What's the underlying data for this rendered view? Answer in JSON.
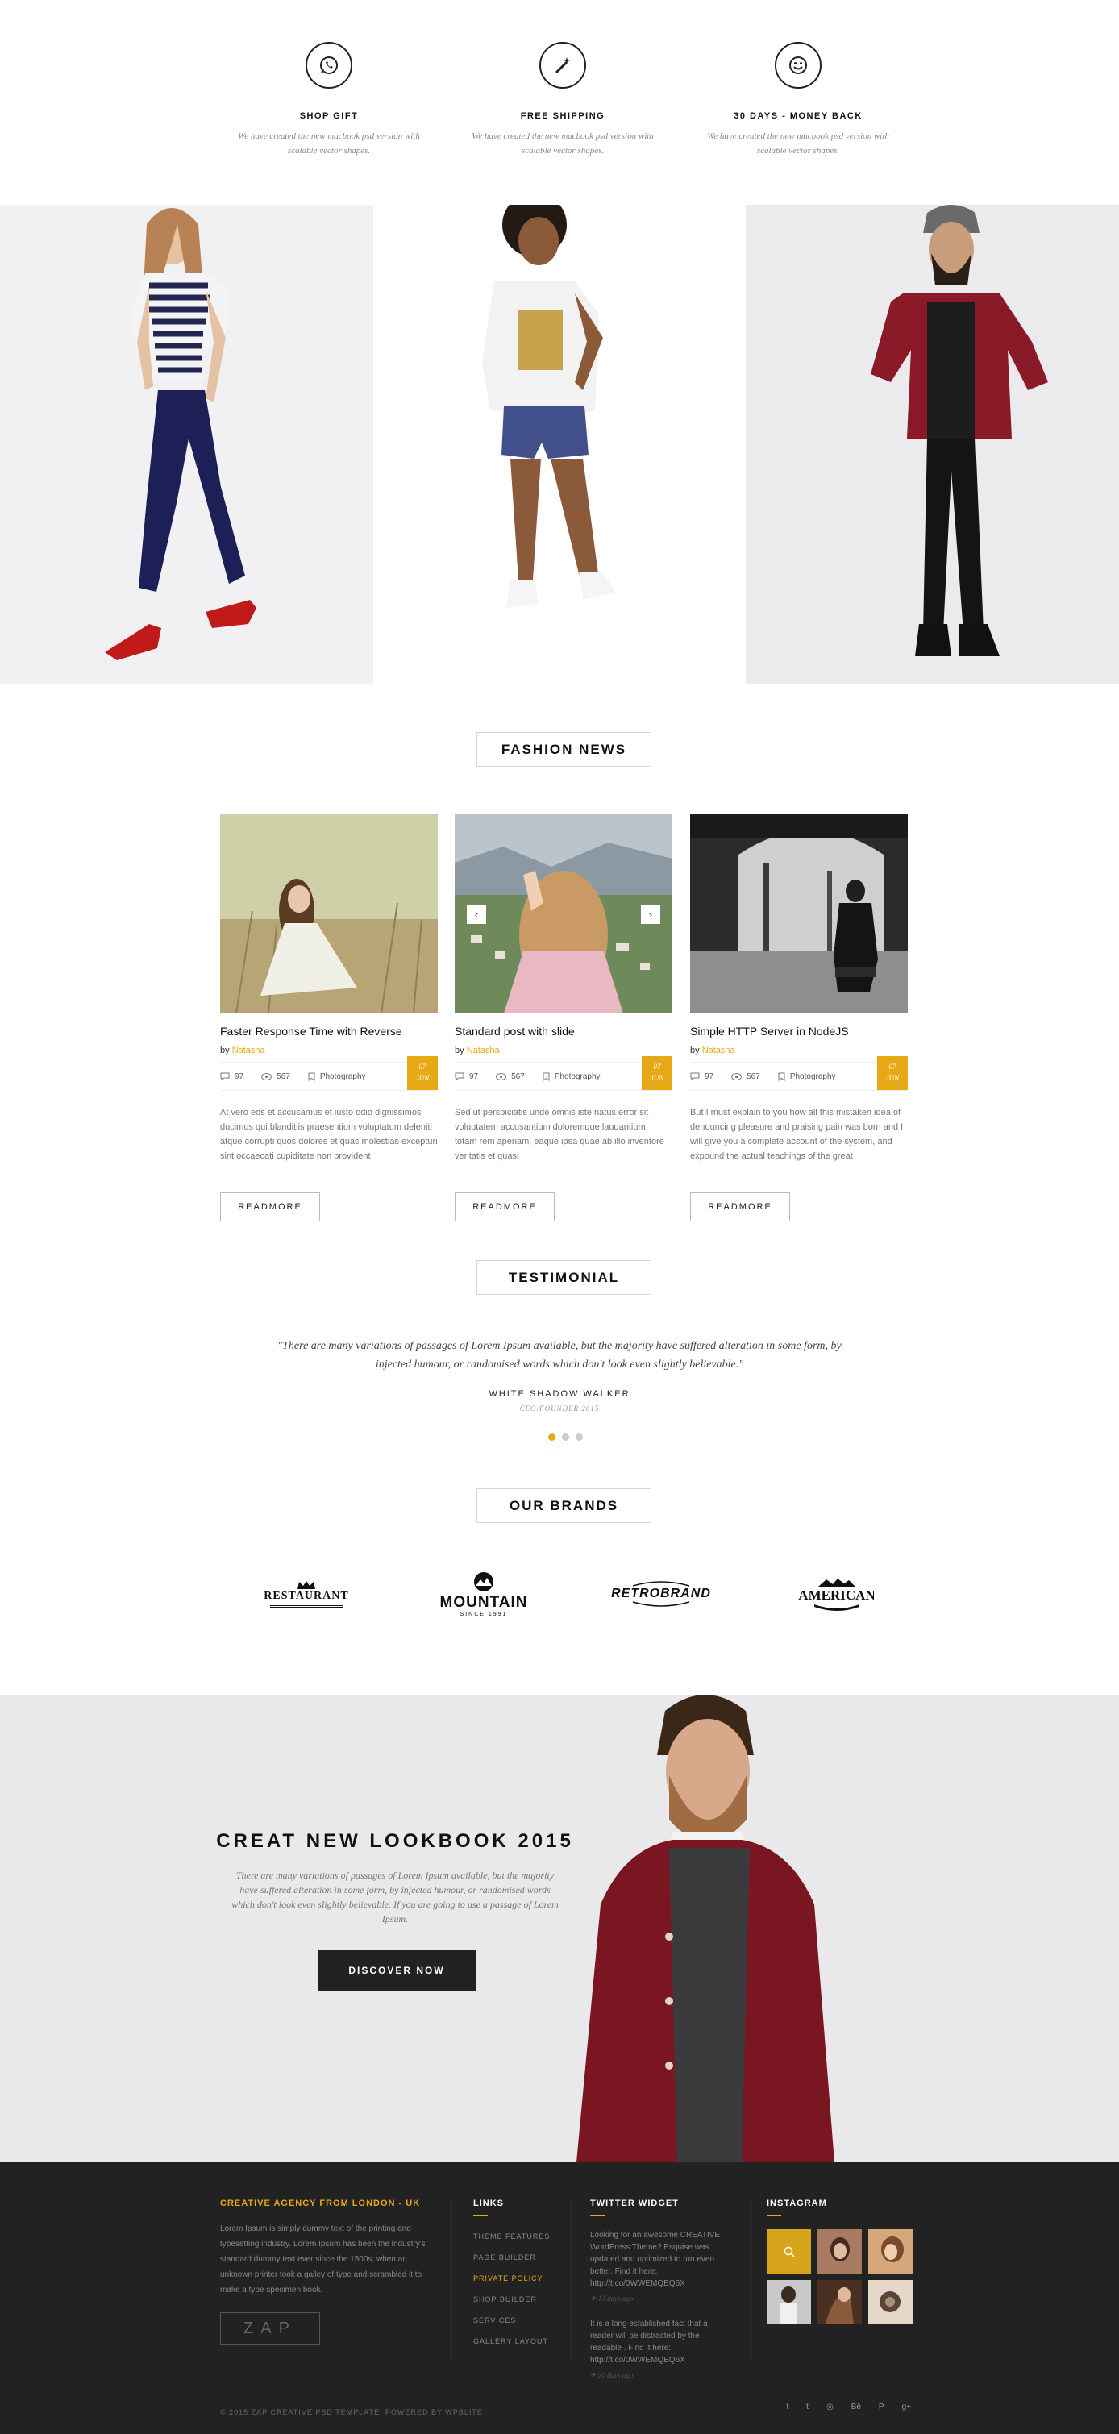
{
  "features": [
    {
      "icon": "whatsapp-icon",
      "title": "SHOP GIFT",
      "desc": "We have created the new macbook psd version with scalable vector shapes."
    },
    {
      "icon": "magic-wand-icon",
      "title": "FREE SHIPPING",
      "desc": "We have created the new macbook psd version with scalable vector shapes."
    },
    {
      "icon": "smile-icon",
      "title": "30 DAYS -  MONEY BACK",
      "desc": "We have created the new macbook psd version with scalable vector shapes."
    }
  ],
  "news": {
    "heading": "FASHION NEWS",
    "posts": [
      {
        "title": "Faster Response Time with Reverse",
        "by": "by",
        "author": "Natasha",
        "comments": "97",
        "views": "567",
        "category": "Photography",
        "day": "07",
        "month": "JUN",
        "excerpt": "At vero eos et accusamus et iusto odio dignissimos ducimus qui blanditiis praesentium voluptatum deleniti atque corrupti quos dolores et quas molestias excepturi sint occaecati cupiditate non provident",
        "button": "READMORE"
      },
      {
        "title": "Standard post with slide",
        "by": "by",
        "author": "Natasha",
        "comments": "97",
        "views": "567",
        "category": "Photography",
        "day": "07",
        "month": "JUN",
        "excerpt": "Sed ut perspiciatis unde omnis iste natus error sit voluptatem accusantium doloremque laudantium, totam rem aperiam, eaque ipsa quae ab illo inventore veritatis et quasi",
        "button": "READMORE",
        "prev": "‹",
        "next": "›"
      },
      {
        "title": "Simple HTTP Server in NodeJS",
        "by": "by",
        "author": "Natasha",
        "comments": "97",
        "views": "567",
        "category": "Photography",
        "day": "07",
        "month": "JUN",
        "excerpt": "But I must explain to you how all this mistaken idea of denouncing pleasure and praising pain was born and I will give you a complete account of the system, and expound the actual teachings of the great",
        "button": "READMORE"
      }
    ]
  },
  "testimonial": {
    "heading": "TESTIMONIAL",
    "quote": "\"There are many variations of passages of Lorem Ipsum available, but the majority have suffered alteration in some form, by injected humour, or randomised words which don't look even slightly believable.\"",
    "author": "WHITE SHADOW WALKER",
    "role": "CEO/FOUNDER 2015"
  },
  "brands": {
    "heading": "OUR BRANDS",
    "items": [
      {
        "name": "RESTAURANT"
      },
      {
        "name": "MOUNTAIN",
        "sub": "SINCE 1991"
      },
      {
        "name": "RETROBRAND"
      },
      {
        "name": "AMERICAN"
      }
    ]
  },
  "lookbook": {
    "title": "CREAT NEW LOOKBOOK 2015",
    "text": "There are many variations of passages of Lorem Ipsum available, but the majority have suffered alteration in some form, by injected humour, or randomised words which don't look even slightly believable. If you are going to use a passage of Lorem Ipsum.",
    "button": "DISCOVER NOW"
  },
  "footer": {
    "about_title": "CREATIVE AGENCY FROM LONDON - UK",
    "about_text": "Lorem Ipsum is simply dummy text of the printing and typesetting industry. Lorem Ipsum has been the industry's standard dummy text ever since the 1500s, when an unknown printer took a galley of type and scrambled it to make a type specimen book.",
    "logo": "ZAP",
    "links_title": "LINKS",
    "links": [
      "THEME FEATURES",
      "PAGE BUILDER",
      "PRIVATE POLICY",
      "SHOP BUILDER",
      "SERVICES",
      "GALLERY LAYOUT"
    ],
    "twitter_title": "TWITTER WIDGET",
    "tweets": [
      {
        "text": "Looking for an awesome CREATIVE WordPress Theme? Esquise was updated and optimized to run even better. Find it here: http://t.co/0WWEMQEQ6X",
        "time": "13 days ago"
      },
      {
        "text": "It is a long established fact that a reader will be distracted by the readable . Find it here: http://t.co/0WWEMQEQ6X",
        "time": "20 days ago"
      }
    ],
    "instagram_title": "INSTAGRAM",
    "copyright": "© 2015 ZAP CREATIVE PSD TEMPLATE. POWERED BY WPBLITE",
    "social": [
      "f",
      "t",
      "◎",
      "Bē",
      "P",
      "g+"
    ]
  }
}
